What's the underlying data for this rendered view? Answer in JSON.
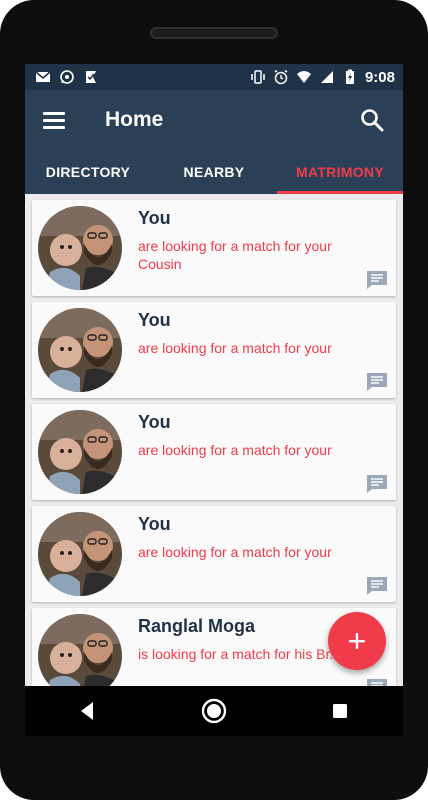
{
  "status_bar": {
    "left_icons": [
      "gmail-icon",
      "whatsapp-icon",
      "app-notification-icon"
    ],
    "right_icons": [
      "vibrate-icon",
      "alarm-icon",
      "wifi-icon",
      "signal-icon",
      "battery-icon"
    ],
    "time": "9:08"
  },
  "toolbar": {
    "title": "Home"
  },
  "tabs": [
    {
      "label": "DIRECTORY",
      "active": false
    },
    {
      "label": "NEARBY",
      "active": false
    },
    {
      "label": "MATRIMONY",
      "active": true
    }
  ],
  "cards": [
    {
      "name": "You",
      "text": "are looking for a match for your Cousin"
    },
    {
      "name": "You",
      "text": "are looking for a match for your"
    },
    {
      "name": "You",
      "text": "are looking for a match for your"
    },
    {
      "name": "You",
      "text": "are looking for a match for your"
    },
    {
      "name": "Ranglal Moga",
      "text": "is looking for a match for his Br..."
    }
  ],
  "fab": {
    "label": "+"
  },
  "colors": {
    "primary": "#2a4057",
    "accent": "#ef3b4a",
    "status": "#1f3247"
  }
}
